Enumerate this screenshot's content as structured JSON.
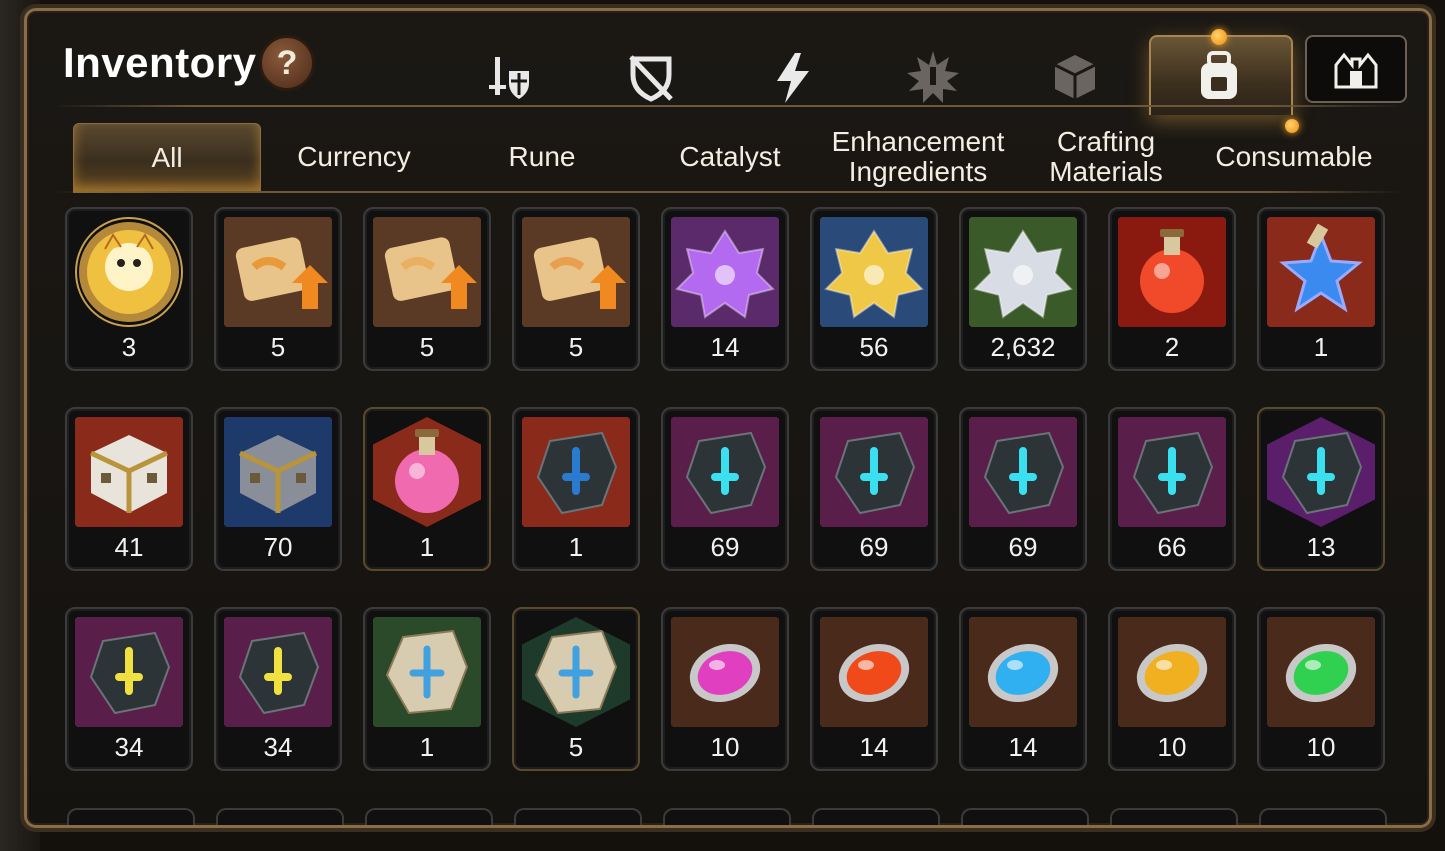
{
  "header": {
    "title": "Inventory",
    "help_symbol": "?"
  },
  "category_icons": [
    {
      "name": "equipment-icon",
      "active": false
    },
    {
      "name": "shield-cross-icon",
      "active": false
    },
    {
      "name": "lightning-icon",
      "active": false
    },
    {
      "name": "splash-icon",
      "active": false
    },
    {
      "name": "cube-icon",
      "active": false
    },
    {
      "name": "backpack-icon",
      "active": true
    },
    {
      "name": "castle-icon",
      "active": false
    }
  ],
  "tabs": [
    {
      "label": "All",
      "active": true
    },
    {
      "label": "Currency",
      "active": false
    },
    {
      "label": "Rune",
      "active": false
    },
    {
      "label": "Catalyst",
      "active": false
    },
    {
      "label": "Enhancement Ingredients",
      "active": false
    },
    {
      "label": "Crafting Materials",
      "active": false
    },
    {
      "label": "Consumable",
      "active": false
    }
  ],
  "items": [
    {
      "name": "phantom-coin",
      "qty": "3",
      "frame": "round",
      "bg": "#b48a3a",
      "accent": "#f0c040",
      "shape": "coin"
    },
    {
      "name": "scroll-fire",
      "qty": "5",
      "frame": "square",
      "bg": "#5a3a24",
      "accent": "#e89a3a",
      "shape": "scroll"
    },
    {
      "name": "scroll-rainbow",
      "qty": "5",
      "frame": "square",
      "bg": "#5a3a24",
      "accent": "#e8b060",
      "shape": "scroll"
    },
    {
      "name": "scroll-gold",
      "qty": "5",
      "frame": "square",
      "bg": "#5a3a24",
      "accent": "#e8a050",
      "shape": "scroll"
    },
    {
      "name": "purple-crystal",
      "qty": "14",
      "frame": "square",
      "bg": "#5a2a6a",
      "accent": "#b36af0",
      "shape": "crystal"
    },
    {
      "name": "gold-crystal",
      "qty": "56",
      "frame": "square",
      "bg": "#2a4a7a",
      "accent": "#f0c848",
      "shape": "crystal"
    },
    {
      "name": "silver-crystal",
      "qty": "2,632",
      "frame": "square",
      "bg": "#3a5a2a",
      "accent": "#d8dce4",
      "shape": "crystal"
    },
    {
      "name": "red-potion",
      "qty": "2",
      "frame": "square",
      "bg": "#8a1a10",
      "accent": "#f04a2a",
      "shape": "potion"
    },
    {
      "name": "star-potion",
      "qty": "1",
      "frame": "square",
      "bg": "#8a2a1a",
      "accent": "#3a8af0",
      "shape": "star"
    },
    {
      "name": "white-chest",
      "qty": "41",
      "frame": "square",
      "bg": "#8a2a1a",
      "accent": "#e8e4dc",
      "shape": "chest"
    },
    {
      "name": "gray-chest",
      "qty": "70",
      "frame": "square",
      "bg": "#1e3a6a",
      "accent": "#8a8e98",
      "shape": "chest"
    },
    {
      "name": "pink-flask",
      "qty": "1",
      "frame": "hex",
      "bg": "#8a2a1a",
      "accent": "#f06ab0",
      "shape": "potion"
    },
    {
      "name": "blue-rune-stone",
      "qty": "1",
      "frame": "square",
      "bg": "#8a2a1a",
      "accent": "#2a7ad0",
      "shape": "rune"
    },
    {
      "name": "rune-sword",
      "qty": "69",
      "frame": "square",
      "bg": "#5a1e4a",
      "accent": "#3ae0f0",
      "shape": "rune"
    },
    {
      "name": "rune-spiral",
      "qty": "69",
      "frame": "square",
      "bg": "#5a1e4a",
      "accent": "#3ae0f0",
      "shape": "rune"
    },
    {
      "name": "rune-armor",
      "qty": "69",
      "frame": "square",
      "bg": "#5a1e4a",
      "accent": "#3ae0f0",
      "shape": "rune"
    },
    {
      "name": "rune-boot",
      "qty": "66",
      "frame": "square",
      "bg": "#5a1e4a",
      "accent": "#3ae0f0",
      "shape": "rune"
    },
    {
      "name": "rune-star-hex",
      "qty": "13",
      "frame": "hex",
      "bg": "#5a1e6a",
      "accent": "#3ae0f0",
      "shape": "rune"
    },
    {
      "name": "rune-hammer",
      "qty": "34",
      "frame": "square",
      "bg": "#5a1e4a",
      "accent": "#f0e040",
      "shape": "rune"
    },
    {
      "name": "rune-bolt",
      "qty": "34",
      "frame": "square",
      "bg": "#5a1e4a",
      "accent": "#f0e040",
      "shape": "rune"
    },
    {
      "name": "stone-sword",
      "qty": "1",
      "frame": "square",
      "bg": "#2a4a2a",
      "accent": "#40a0e0",
      "shape": "stone"
    },
    {
      "name": "stone-star-hex",
      "qty": "5",
      "frame": "hex",
      "bg": "#1e3a2a",
      "accent": "#40a0e0",
      "shape": "stone"
    },
    {
      "name": "orb-purple",
      "qty": "10",
      "frame": "square",
      "bg": "#4a2a1a",
      "accent": "#e040c0",
      "shape": "orb"
    },
    {
      "name": "orb-red",
      "qty": "14",
      "frame": "square",
      "bg": "#4a2a1a",
      "accent": "#f04a1a",
      "shape": "orb"
    },
    {
      "name": "orb-blue",
      "qty": "14",
      "frame": "square",
      "bg": "#4a2a1a",
      "accent": "#30b0f0",
      "shape": "orb"
    },
    {
      "name": "orb-yellow",
      "qty": "10",
      "frame": "square",
      "bg": "#4a2a1a",
      "accent": "#f0b020",
      "shape": "orb"
    },
    {
      "name": "orb-green",
      "qty": "10",
      "frame": "square",
      "bg": "#4a2a1a",
      "accent": "#30d050",
      "shape": "orb"
    }
  ],
  "colors": {
    "border_gold": "#8a6d45",
    "notification_dot": "#f0a020"
  }
}
